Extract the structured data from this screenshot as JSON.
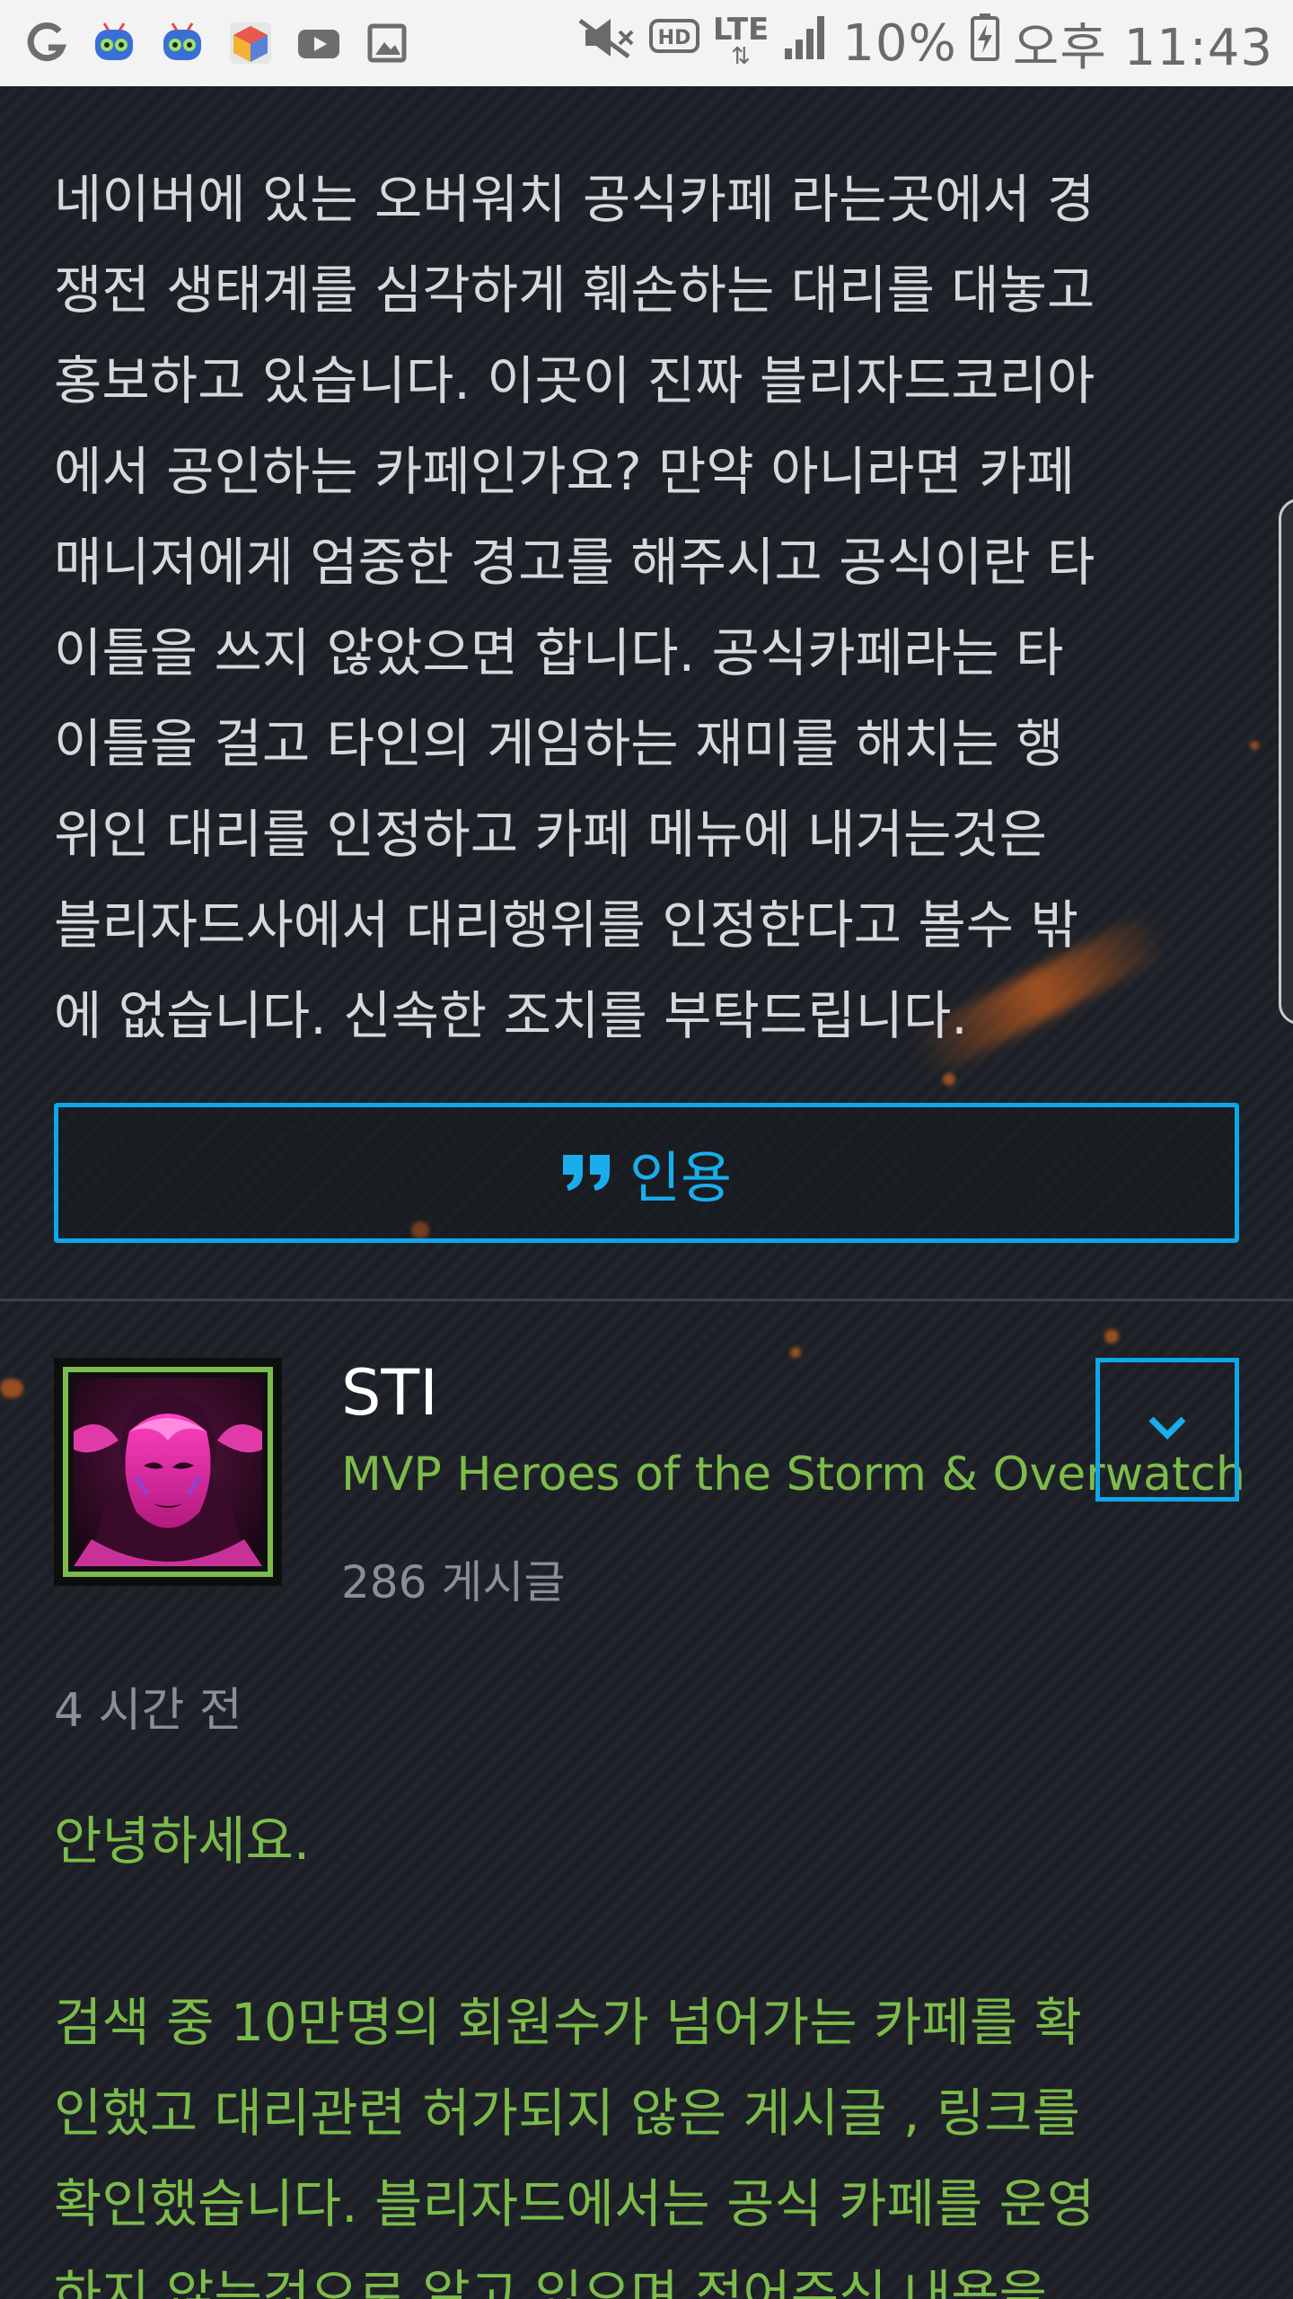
{
  "status_bar": {
    "network": "LTE",
    "battery_percent": "10%",
    "time": "오후 11:43",
    "icons": [
      "g-app-icon",
      "bot-app-icon",
      "bot-app-icon-2",
      "gallery-cube-icon",
      "youtube-icon",
      "image-icon",
      "mute-icon",
      "hd-icon",
      "lte-icon",
      "signal-icon",
      "battery-charging-icon"
    ]
  },
  "post": {
    "body_lines": [
      "네이버에 있는 오버워치 공식카페 라는곳에서 경",
      "쟁전 생태계를 심각하게 훼손하는 대리를 대놓고",
      "홍보하고 있습니다. 이곳이 진짜 블리자드코리아",
      "에서 공인하는 카페인가요? 만약 아니라면 카페",
      "매니저에게 엄중한 경고를 해주시고 공식이란 타",
      "이틀을 쓰지 않았으면 합니다. 공식카페라는 타",
      "이틀을 걸고 타인의 게임하는 재미를 해치는 행",
      "위인 대리를 인정하고 카페 메뉴에 내거는것은",
      "블리자드사에서 대리행위를 인정한다고 볼수 밖",
      "에 없습니다. 신속한 조치를 부탁드립니다."
    ],
    "quote_label": "인용"
  },
  "reply": {
    "author": "STI",
    "title": "MVP Heroes of the Storm & Overwatch",
    "post_count": "286 게시글",
    "timestamp": "4 시간 전",
    "greeting": "안녕하세요.",
    "body_lines": [
      "검색 중 10만명의 회원수가 넘어가는 카페를 확",
      "인했고 대리관련 허가되지 않은 게시글 , 링크를",
      "확인했습니다. 블리자드에서는 공식 카페를 운영",
      "하지 않는것으로 알고 있으며 적어주신 내용을"
    ]
  },
  "colors": {
    "accent_blue": "#10a6e8",
    "mvp_green": "#7dbb4b",
    "background": "#1d2127"
  }
}
